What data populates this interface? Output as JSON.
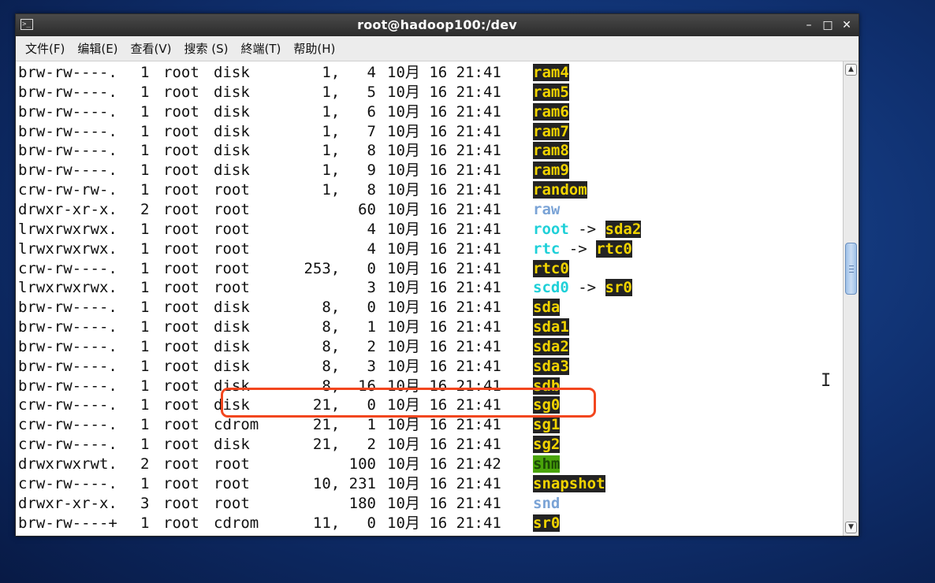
{
  "window": {
    "title": "root@hadoop100:/dev"
  },
  "menu": [
    "文件(F)",
    "编辑(E)",
    "查看(V)",
    "搜索 (S)",
    "終端(T)",
    "帮助(H)"
  ],
  "rows": [
    {
      "perm": "brw-rw----.",
      "links": "1",
      "owner": "root",
      "group": "disk",
      "size": "1,   4",
      "date": "10月 16 21:41",
      "name": "ram4",
      "style": "device"
    },
    {
      "perm": "brw-rw----.",
      "links": "1",
      "owner": "root",
      "group": "disk",
      "size": "1,   5",
      "date": "10月 16 21:41",
      "name": "ram5",
      "style": "device"
    },
    {
      "perm": "brw-rw----.",
      "links": "1",
      "owner": "root",
      "group": "disk",
      "size": "1,   6",
      "date": "10月 16 21:41",
      "name": "ram6",
      "style": "device"
    },
    {
      "perm": "brw-rw----.",
      "links": "1",
      "owner": "root",
      "group": "disk",
      "size": "1,   7",
      "date": "10月 16 21:41",
      "name": "ram7",
      "style": "device"
    },
    {
      "perm": "brw-rw----.",
      "links": "1",
      "owner": "root",
      "group": "disk",
      "size": "1,   8",
      "date": "10月 16 21:41",
      "name": "ram8",
      "style": "device"
    },
    {
      "perm": "brw-rw----.",
      "links": "1",
      "owner": "root",
      "group": "disk",
      "size": "1,   9",
      "date": "10月 16 21:41",
      "name": "ram9",
      "style": "device"
    },
    {
      "perm": "crw-rw-rw-.",
      "links": "1",
      "owner": "root",
      "group": "root",
      "size": "1,   8",
      "date": "10月 16 21:41",
      "name": "random",
      "style": "device"
    },
    {
      "perm": "drwxr-xr-x.",
      "links": "2",
      "owner": "root",
      "group": "root",
      "size": "60",
      "date": "10月 16 21:41",
      "name": "raw",
      "style": "dir"
    },
    {
      "perm": "lrwxrwxrwx.",
      "links": "1",
      "owner": "root",
      "group": "root",
      "size": "4",
      "date": "10月 16 21:41",
      "name": "root",
      "style": "link",
      "target": "sda2"
    },
    {
      "perm": "lrwxrwxrwx.",
      "links": "1",
      "owner": "root",
      "group": "root",
      "size": "4",
      "date": "10月 16 21:41",
      "name": "rtc",
      "style": "link",
      "target": "rtc0"
    },
    {
      "perm": "crw-rw----.",
      "links": "1",
      "owner": "root",
      "group": "root",
      "size": "253,   0",
      "date": "10月 16 21:41",
      "name": "rtc0",
      "style": "device"
    },
    {
      "perm": "lrwxrwxrwx.",
      "links": "1",
      "owner": "root",
      "group": "root",
      "size": "3",
      "date": "10月 16 21:41",
      "name": "scd0",
      "style": "link",
      "target": "sr0"
    },
    {
      "perm": "brw-rw----.",
      "links": "1",
      "owner": "root",
      "group": "disk",
      "size": "8,   0",
      "date": "10月 16 21:41",
      "name": "sda",
      "style": "device"
    },
    {
      "perm": "brw-rw----.",
      "links": "1",
      "owner": "root",
      "group": "disk",
      "size": "8,   1",
      "date": "10月 16 21:41",
      "name": "sda1",
      "style": "device"
    },
    {
      "perm": "brw-rw----.",
      "links": "1",
      "owner": "root",
      "group": "disk",
      "size": "8,   2",
      "date": "10月 16 21:41",
      "name": "sda2",
      "style": "device"
    },
    {
      "perm": "brw-rw----.",
      "links": "1",
      "owner": "root",
      "group": "disk",
      "size": "8,   3",
      "date": "10月 16 21:41",
      "name": "sda3",
      "style": "device"
    },
    {
      "perm": "brw-rw----.",
      "links": "1",
      "owner": "root",
      "group": "disk",
      "size": "8,  16",
      "date": "10月 16 21:41",
      "name": "sdb",
      "style": "device"
    },
    {
      "perm": "crw-rw----.",
      "links": "1",
      "owner": "root",
      "group": "disk",
      "size": "21,   0",
      "date": "10月 16 21:41",
      "name": "sg0",
      "style": "device"
    },
    {
      "perm": "crw-rw----.",
      "links": "1",
      "owner": "root",
      "group": "cdrom",
      "size": "21,   1",
      "date": "10月 16 21:41",
      "name": "sg1",
      "style": "device"
    },
    {
      "perm": "crw-rw----.",
      "links": "1",
      "owner": "root",
      "group": "disk",
      "size": "21,   2",
      "date": "10月 16 21:41",
      "name": "sg2",
      "style": "device"
    },
    {
      "perm": "drwxrwxrwt.",
      "links": "2",
      "owner": "root",
      "group": "root",
      "size": "100",
      "date": "10月 16 21:42",
      "name": "shm",
      "style": "sticky"
    },
    {
      "perm": "crw-rw----.",
      "links": "1",
      "owner": "root",
      "group": "root",
      "size": "10, 231",
      "date": "10月 16 21:41",
      "name": "snapshot",
      "style": "device"
    },
    {
      "perm": "drwxr-xr-x.",
      "links": "3",
      "owner": "root",
      "group": "root",
      "size": "180",
      "date": "10月 16 21:41",
      "name": "snd",
      "style": "dir"
    },
    {
      "perm": "brw-rw----+",
      "links": "1",
      "owner": "root",
      "group": "cdrom",
      "size": "11,   0",
      "date": "10月 16 21:41",
      "name": "sr0",
      "style": "device"
    }
  ],
  "highlight_row": "sdb",
  "colors": {
    "device_bg": "#232323",
    "device_fg": "#f1d400",
    "link": "#1fd0d8",
    "dir": "#7aa3d6",
    "sticky_bg": "#4aa50a",
    "annotation": "#f2461e"
  },
  "icons": {
    "app": "terminal-icon",
    "cursor": "i-beam-cursor-icon"
  }
}
